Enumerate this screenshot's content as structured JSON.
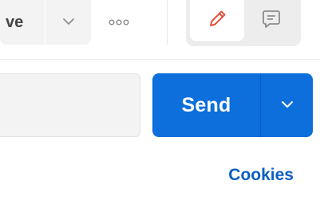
{
  "toolbar": {
    "save_label": "ve",
    "save_dropdown_icon": "chevron-down-icon",
    "more_icon": "ellipsis-icon",
    "edit_icon": "pencil-icon",
    "comment_icon": "comment-icon"
  },
  "request": {
    "url_value": "",
    "send_label": "Send",
    "send_dropdown_icon": "chevron-down-icon"
  },
  "links": {
    "cookies_label": "Cookies"
  },
  "colors": {
    "send_blue": "#0c6fdc",
    "link_blue": "#0b5fc2",
    "edit_icon": "#e5533d",
    "muted_icon": "#8d8d8d"
  }
}
